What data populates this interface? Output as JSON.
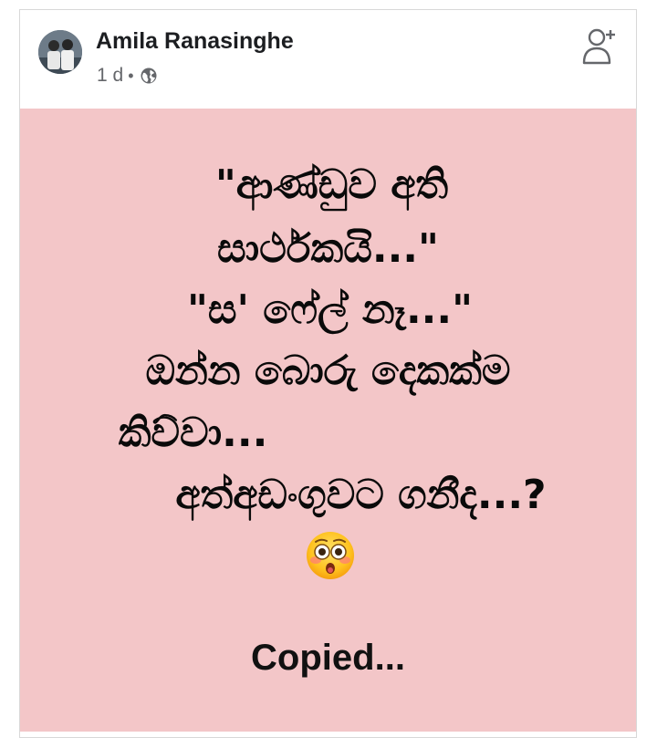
{
  "post": {
    "author_name": "Amila Ranasinghe",
    "time": "1 d",
    "separator": "•",
    "audience_icon": "globe-icon",
    "action_icon": "add-friend-icon"
  },
  "body": {
    "background": "#f3c6c8",
    "lines": [
      "\"ආණ්ඩුව අති",
      "සාර්ථකයි...\"",
      "\"ස' ෆේල් නෑ...\"",
      "ඔන්න බොරු දෙකක්ම",
      "කිව්වා...",
      "අත්අඩංගුවට ගනීද...?"
    ],
    "emoji": "flushed-face-emoji",
    "footer_text": "Copied..."
  }
}
